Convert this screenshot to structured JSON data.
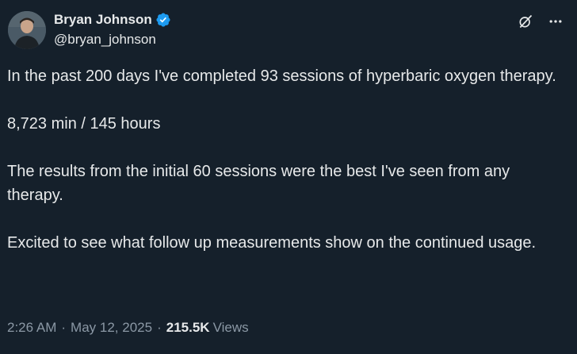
{
  "author": {
    "display_name": "Bryan Johnson",
    "handle": "@bryan_johnson",
    "verified": true,
    "verified_color": "#1d9bf0"
  },
  "icons": {
    "grok": "grok-icon",
    "more": "more-icon"
  },
  "tweet": {
    "paragraphs": [
      "In the past 200 days I've completed 93 sessions of hyperbaric oxygen therapy.",
      "8,723 min / 145 hours",
      "The results from the initial 60 sessions were the best I've seen from any therapy.",
      "Excited to see what follow up measurements show on the continued usage."
    ]
  },
  "meta": {
    "time": "2:26 AM",
    "date": "May 12, 2025",
    "views_count": "215.5K",
    "views_label": "Views",
    "separator": "·"
  },
  "colors": {
    "background": "#15202b",
    "text": "#e7e9ea",
    "secondary": "#8b98a5"
  }
}
